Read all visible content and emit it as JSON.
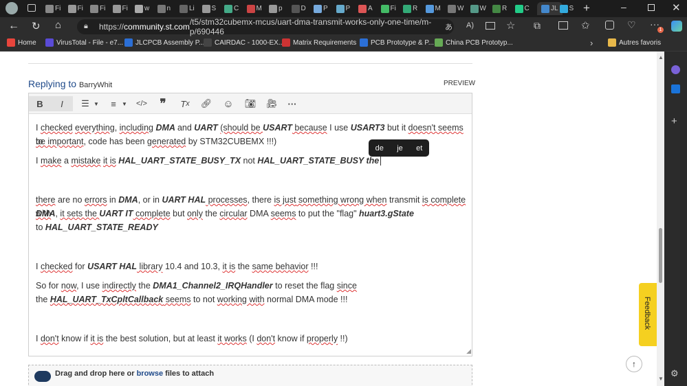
{
  "browser": {
    "tabs": [
      {
        "label": "Fi"
      },
      {
        "label": "Fi"
      },
      {
        "label": "Fi"
      },
      {
        "label": "Fi"
      },
      {
        "label": "w"
      },
      {
        "label": "n"
      },
      {
        "label": "Li"
      },
      {
        "label": "S"
      },
      {
        "label": "C"
      },
      {
        "label": "M"
      },
      {
        "label": "p"
      },
      {
        "label": "D"
      },
      {
        "label": "P"
      },
      {
        "label": "P"
      },
      {
        "label": "A"
      },
      {
        "label": "Fi"
      },
      {
        "label": "R"
      },
      {
        "label": "M"
      },
      {
        "label": "W"
      },
      {
        "label": "W"
      },
      {
        "label": "R"
      },
      {
        "label": "C"
      },
      {
        "label": "JL"
      },
      {
        "label": "S"
      }
    ],
    "active_tab_label": "JL",
    "url_prefix": "https://",
    "url_domain": "community.st.com",
    "url_path": "/t5/stm32cubemx-mcus/uart-dma-transmit-works-only-one-time/m-p/690446",
    "bookmarks": [
      {
        "label": "Home"
      },
      {
        "label": "VirusTotal - File - e7..."
      },
      {
        "label": "JLCPCB Assembly P..."
      },
      {
        "label": "CAIRDAC - 1000-EX..."
      },
      {
        "label": "Matrix Requirements"
      },
      {
        "label": "PCB Prototype & P..."
      },
      {
        "label": "China PCB Prototyp..."
      }
    ],
    "other_favorites": "Autres favoris",
    "badge_count": "1"
  },
  "reply": {
    "prefix": "Replying to",
    "user": "BarryWhit",
    "preview_label": "PREVIEW"
  },
  "editor": {
    "bold": "B",
    "italic": "I",
    "lines": {
      "l1a": "I ",
      "l1b": "checked",
      "l1c": " ",
      "l1d": "everything",
      ", ": ", ",
      "l1e": "including",
      "l1f": " DMA ",
      "l1g": "and",
      "l1h": " UART ",
      "l1i": "(should be ",
      "l1j": "USART",
      "l1k": " because",
      "l1l": " I use ",
      "l1m": "USART3",
      "l1n": " but it ",
      "l1o": "doesn't seems",
      "l1p": " to",
      "l2a": "be important",
      "l2b": ", code has been ",
      "l2c": "generated",
      "l2d": " by STM32CUBEMX !!!)",
      "l3a": "I ",
      "l3b": "make",
      "l3c": " a ",
      "l3d": "mistake",
      "l3e": "it is",
      "l3f": " HAL_UART_STATE_BUSY_TX",
      "l3g": " not ",
      "l3h": "HAL_UART_STATE_BUSY the",
      "l4a": "there",
      "l4b": " are no ",
      "l4c": "errors",
      "l4d": " in ",
      "l4e": "DMA",
      ", or in ": ", or in ",
      "l4f": "UART HAL",
      "l4g": " processes",
      ", there ": ", there ",
      "l4h": "is just",
      "l4i": " something wrong when",
      "l4j": " transmit ",
      "l4k": "is complete with",
      "l5a": "DMA",
      "l5b": "it sets the ",
      "l5c": "UART IT",
      "l5d": " complete",
      "l5e": " but ",
      "l5f": "only",
      "l5g": " the ",
      "l5h": "circular",
      "l5i": " DMA ",
      "l5j": "seems",
      "l5k": " to put the \"flag\" ",
      "l5l": "huart3.gState",
      "l6a": "to ",
      "l6b": "HAL_UART_STATE_READY",
      "l7a": "I ",
      "l7b": "checked",
      "l7c": " for ",
      "l7d": "USART HAL",
      "l7e": " library",
      "l7f": " 10.4 and 10.3, ",
      "l7g": "it is",
      "l7h": " the ",
      "l7i": "same behavior",
      "l7j": " !!!",
      "l8a": "So for ",
      "l8b": "now",
      ", I use ": ", I use ",
      "l8c": "indirectly",
      "l8d": " the ",
      "l8e": "DMA1_Channel2_IRQHandler",
      "l8f": " to reset the flag ",
      "l8g": "since",
      "l9a": "the ",
      "l9b": "HAL_UART_TxCpltCallback",
      "l9c": " seems",
      "l9d": " to not ",
      "l9e": "working with",
      "l9f": " normal DMA mode !!!",
      "l10a": "I ",
      "l10b": "don't",
      "l10c": " know if ",
      "l10d": "it is",
      "l10e": " the best solution, but at least ",
      "l10f": "it works",
      "l10g": " (I ",
      "l10h": "don't",
      "l10i": " know if ",
      "l10j": "properly",
      "l10k": " !!)"
    },
    "suggestions": [
      "de",
      "je",
      "et"
    ]
  },
  "attach": {
    "text1": "Drag and drop here or ",
    "link": "browse",
    "text2": " files to attach"
  },
  "feedback": "Feedback"
}
